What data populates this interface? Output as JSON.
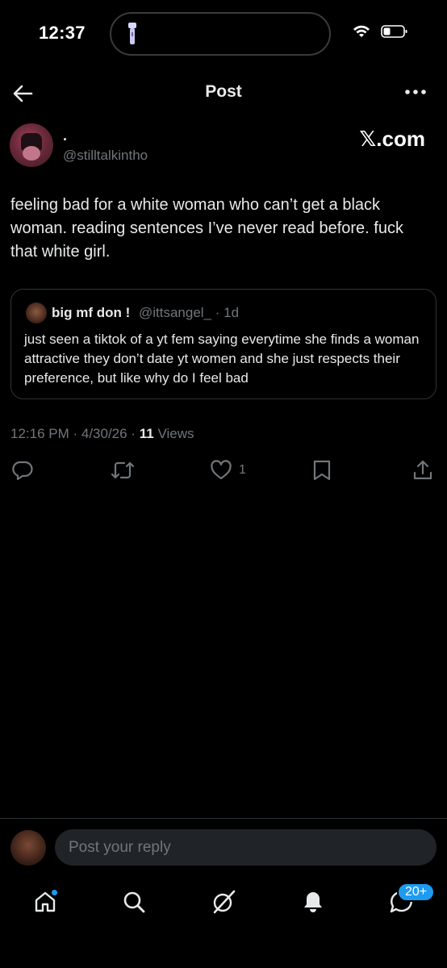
{
  "status_bar": {
    "time": "12:37"
  },
  "nav": {
    "title": "Post"
  },
  "post": {
    "author_name": ".",
    "author_handle": "@stilltalkintho",
    "watermark": "𝕏.com",
    "text": "feeling bad for a white woman who can’t get a black woman. reading sentences I’ve never read before. fuck that white girl.",
    "time": "12:16 PM",
    "date": "4/30/26",
    "views_count": "11",
    "views_label": "Views",
    "like_count": "1"
  },
  "quote": {
    "name": "big mf don !",
    "handle": "@ittsangel_",
    "age": "1d",
    "text": "just seen a tiktok of a yt fem saying everytime she finds a woman attractive they don’t date yt women and she just respects their preference, but like why do I feel bad"
  },
  "reply": {
    "placeholder": "Post your reply"
  },
  "tabbar": {
    "messages_badge": "20+"
  },
  "colors": {
    "background": "#000000",
    "text": "#e7e9ea",
    "muted": "#71767b",
    "border": "#2f3336",
    "accent": "#1d9bf0"
  },
  "icons": [
    "back-arrow-icon",
    "more-icon",
    "reply-icon",
    "repost-icon",
    "like-icon",
    "bookmark-icon",
    "share-icon",
    "home-icon",
    "search-icon",
    "grok-icon",
    "notifications-icon",
    "messages-icon"
  ]
}
